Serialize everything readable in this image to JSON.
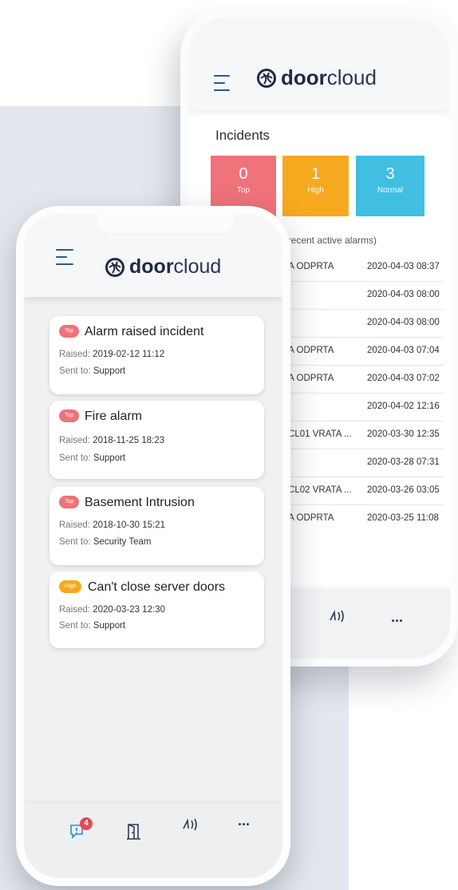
{
  "colors": {
    "top": "#f0727a",
    "high": "#f6a91f",
    "normal": "#40bfe3",
    "brand_dark": "#1e2b45",
    "accent": "#2a8fc9"
  },
  "back_phone": {
    "logo": {
      "bold": "door",
      "light": "cloud",
      "icon": "globe-icon"
    },
    "incidents_title": "Incidents",
    "tiles": [
      {
        "value": "0",
        "label": "Top"
      },
      {
        "value": "1",
        "label": "High"
      },
      {
        "value": "3",
        "label": "Normal"
      }
    ],
    "recent_caption": ") Most recent active alarms)",
    "alarms": [
      {
        "name": "RATA ODPRTA",
        "time": "2020-04-03 08:37"
      },
      {
        "name": "",
        "time": "2020-04-03 08:00"
      },
      {
        "name": "",
        "time": "2020-04-03 08:00"
      },
      {
        "name": "RATA ODPRTA",
        "time": "2020-04-03 07:04"
      },
      {
        "name": "RATA ODPRTA",
        "time": "2020-04-03 07:02"
      },
      {
        "name": "",
        "time": "2020-04-02 12:16"
      },
      {
        "name": ":MRCL01 VRATA ...",
        "time": "2020-03-30 12:35"
      },
      {
        "name": "TA",
        "time": "2020-03-28 07:31"
      },
      {
        "name": ":MRCL02 VRATA ...",
        "time": "2020-03-26 03:05"
      },
      {
        "name": "RATA ODPRTA",
        "time": "2020-03-25 11:08"
      }
    ],
    "nav": {
      "door_icon": "door-icon",
      "nfc_icon": "nfc-icon",
      "more": "..."
    }
  },
  "front_phone": {
    "logo": {
      "bold": "door",
      "light": "cloud",
      "icon": "globe-icon"
    },
    "incidents": [
      {
        "priority": "Top",
        "title": "Alarm raised incident",
        "raised_label": "Raised:",
        "raised": "2019-02-12 11:12",
        "sent_label": "Sent to:",
        "sent_to": "Support"
      },
      {
        "priority": "Top",
        "title": "Fire alarm",
        "raised_label": "Raised:",
        "raised": "2018-11-25 18:23",
        "sent_label": "Sent to:",
        "sent_to": "Support"
      },
      {
        "priority": "Top",
        "title": "Basement Intrusion",
        "raised_label": "Raised:",
        "raised": "2018-10-30 15:21",
        "sent_label": "Sent to:",
        "sent_to": "Security Team"
      },
      {
        "priority": "High",
        "title": "Can't close server doors",
        "raised_label": "Raised:",
        "raised": "2020-03-23 12:30",
        "sent_label": "Sent to:",
        "sent_to": "Support"
      }
    ],
    "nav": {
      "alarms_count": "4",
      "alarms_icon": "alarm-bubble-icon",
      "door_icon": "door-icon",
      "nfc_icon": "nfc-icon",
      "more": "..."
    }
  }
}
